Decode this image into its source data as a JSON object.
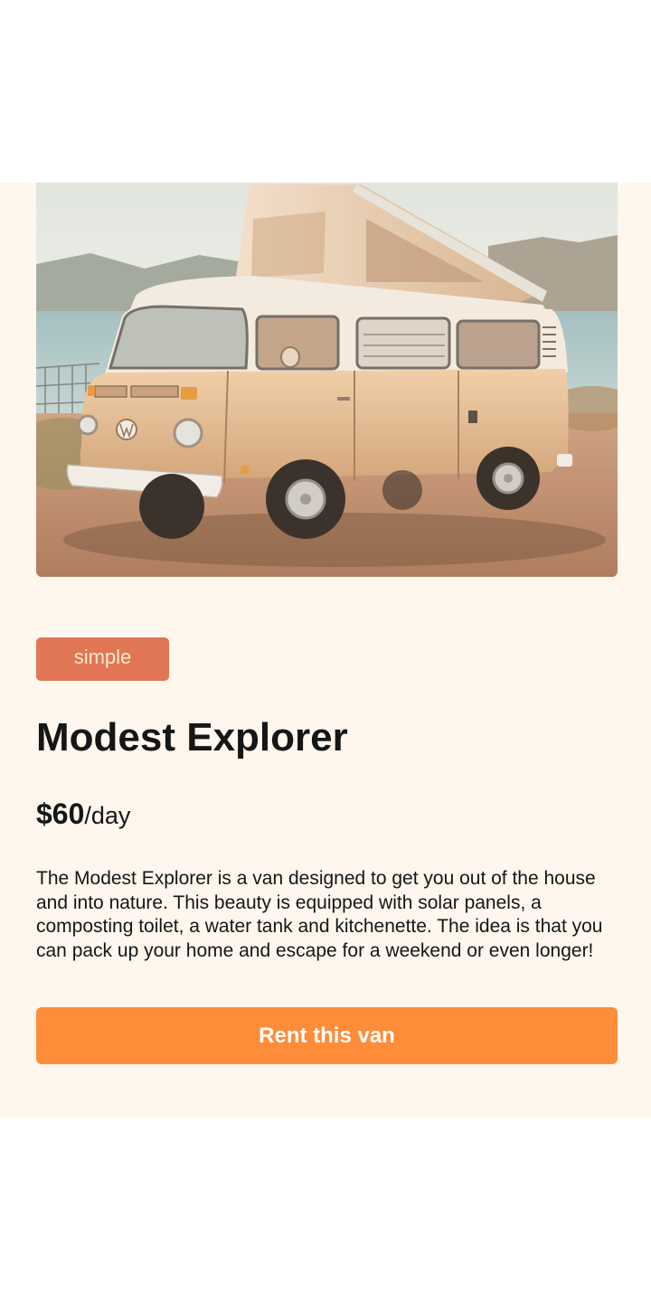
{
  "van": {
    "image_alt": "Modest Explorer van",
    "type": "simple",
    "name": "Modest Explorer",
    "price_amount": "$60",
    "price_unit": "/day",
    "description": "The Modest Explorer is a van designed to get you out of the house and into nature. This beauty is equipped with solar panels, a composting toilet, a water tank and kitchenette. The idea is that you can pack up your home and escape for a weekend or even longer!"
  },
  "actions": {
    "rent_label": "Rent this van"
  },
  "colors": {
    "card_background": "#fff7ed",
    "badge_simple": "#e17654",
    "button": "#ff8c38",
    "text": "#161616"
  }
}
